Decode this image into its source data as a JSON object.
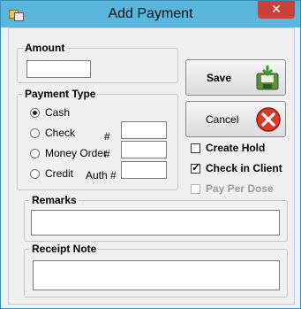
{
  "window": {
    "title": "Add Payment",
    "close_glyph": "✕"
  },
  "amount": {
    "label": "Amount",
    "value": ""
  },
  "payment_type": {
    "label": "Payment Type",
    "options": [
      {
        "label": "Cash",
        "selected": true
      },
      {
        "label": "Check",
        "selected": false,
        "field_label": "#",
        "value": ""
      },
      {
        "label": "Money Order",
        "selected": false,
        "field_label": "#",
        "value": ""
      },
      {
        "label": "Credit",
        "selected": false,
        "field_label": "Auth #",
        "value": ""
      }
    ]
  },
  "buttons": {
    "save": "Save",
    "cancel": "Cancel"
  },
  "checkboxes": {
    "create_hold": {
      "label": "Create Hold",
      "checked": false,
      "enabled": true
    },
    "check_in_client": {
      "label": "Check in Client",
      "checked": true,
      "enabled": true,
      "mark": "✓"
    },
    "pay_per_dose": {
      "label": "Pay Per Dose",
      "checked": false,
      "enabled": false
    }
  },
  "remarks": {
    "label": "Remarks",
    "value": ""
  },
  "receipt_note": {
    "label": "Receipt Note",
    "value": ""
  },
  "icons": {
    "save": "save-to-disk-arrow-icon",
    "cancel": "red-x-circle-icon",
    "app": "window-app-icon"
  },
  "colors": {
    "titlebar": "#5bb6dd",
    "close": "#c9413a",
    "disabled_text": "#9a9a9a"
  }
}
